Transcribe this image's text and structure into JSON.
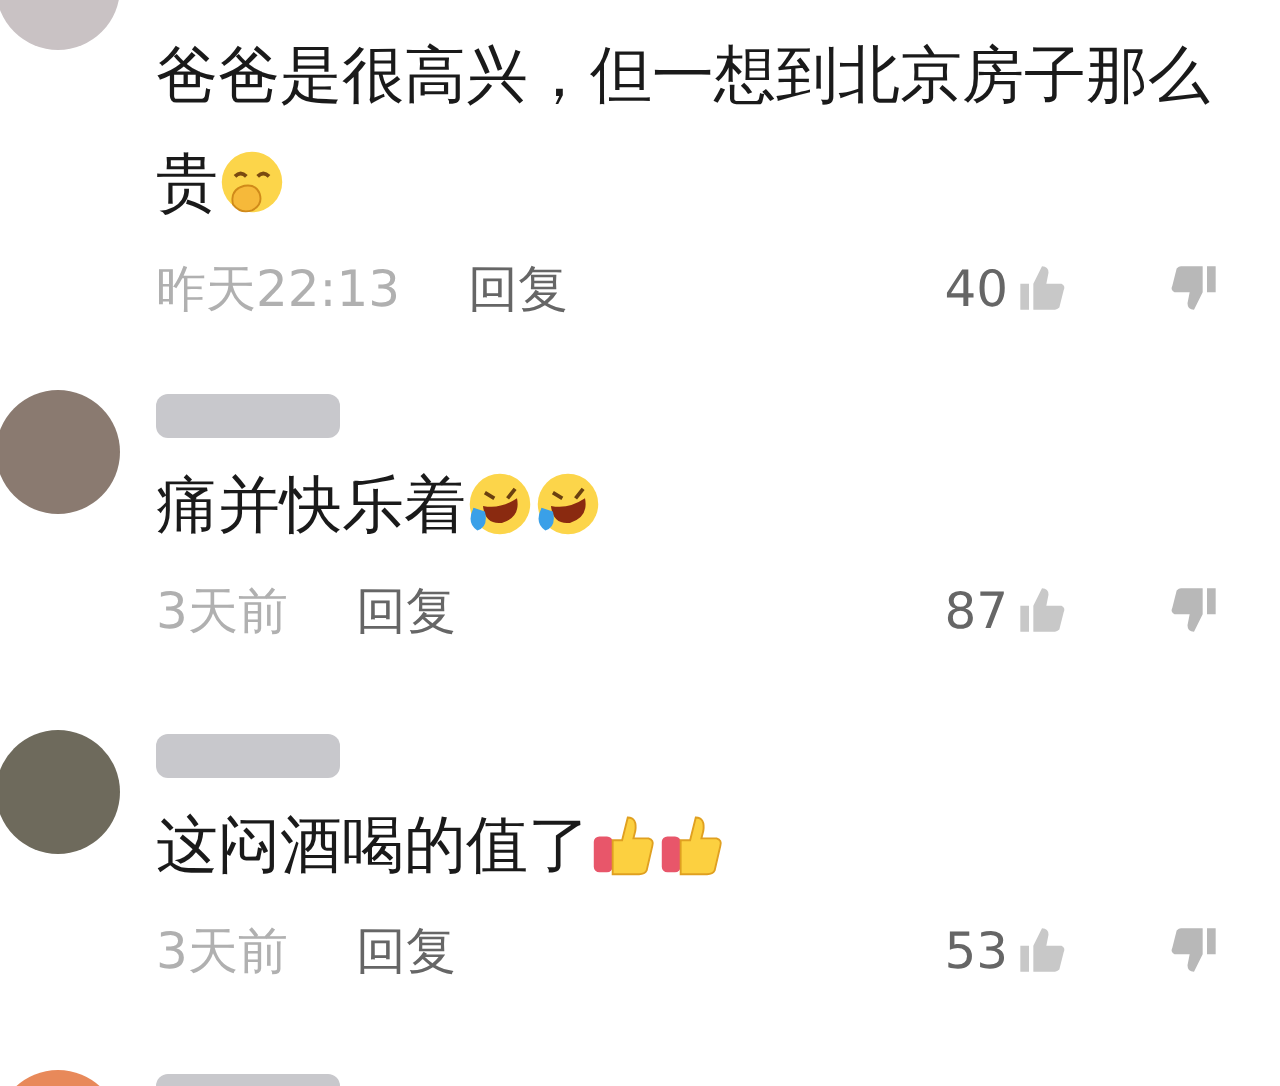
{
  "comments": [
    {
      "color": "#c9c2c4",
      "name_blurred": false,
      "text": "爸爸是很高兴，但一想到北京房子那么贵",
      "emojis": [
        {
          "kind": "hand-over-mouth"
        }
      ],
      "time": "昨天22:13",
      "reply": "回复",
      "likes": "40"
    },
    {
      "color": "#8a7a70",
      "name_blurred": true,
      "text": "痛并快乐着",
      "emojis": [
        {
          "kind": "laugh-tears"
        },
        {
          "kind": "laugh-tears"
        }
      ],
      "time": "3天前",
      "reply": "回复",
      "likes": "87"
    },
    {
      "color": "#6e6a5c",
      "name_blurred": true,
      "text": "这闷酒喝的值了",
      "emojis": [
        {
          "kind": "thumbs-up"
        },
        {
          "kind": "thumbs-up"
        }
      ],
      "time": "3天前",
      "reply": "回复",
      "likes": "53"
    },
    {
      "color": "#e8895a",
      "name_blurred": true
    }
  ]
}
